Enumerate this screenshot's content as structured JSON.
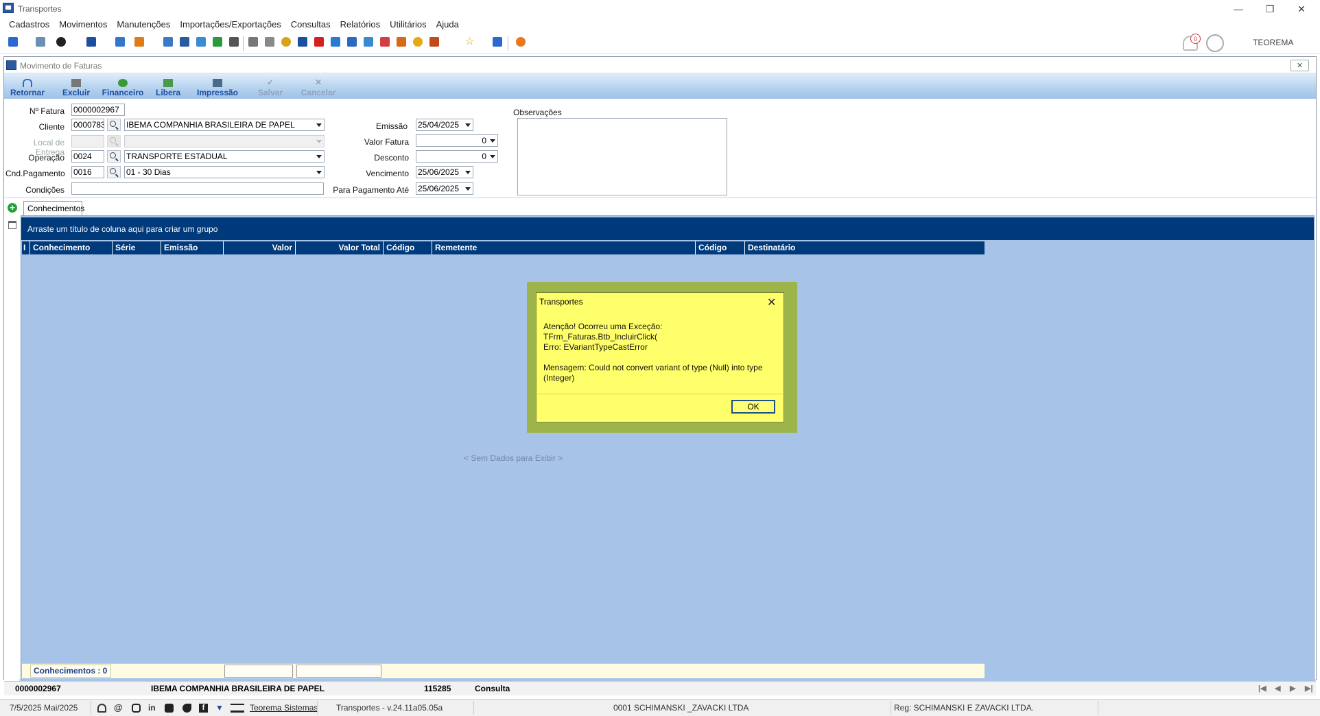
{
  "app": {
    "title": "Transportes",
    "user": "TEOREMA",
    "notifications": "0"
  },
  "menu": [
    "Cadastros",
    "Movimentos",
    "Manutenções",
    "Importações/Exportações",
    "Consultas",
    "Relatórios",
    "Utilitários",
    "Ajuda"
  ],
  "child_window": {
    "title": "Movimento de Faturas"
  },
  "ribbon": {
    "retornar": "Retornar",
    "excluir": "Excluir",
    "financeiro": "Financeiro",
    "libera": "Libera",
    "impressao": "Impressão",
    "salvar": "Salvar",
    "cancelar": "Cancelar"
  },
  "form": {
    "nfatura_label": "Nº Fatura",
    "nfatura": "0000002967",
    "cliente_label": "Cliente",
    "cliente_code": "0000783",
    "cliente_name": "IBEMA COMPANHIA BRASILEIRA DE PAPEL",
    "local_label": "Local de Entrega",
    "operacao_label": "Operação",
    "operacao_code": "0024",
    "operacao_name": "TRANSPORTE ESTADUAL",
    "cndpag_label": "Cnd.Pagamento",
    "cndpag_code": "0016",
    "cndpag_name": "01 - 30 Dias",
    "condicoes_label": "Condições",
    "condicoes": "",
    "emissao_label": "Emissão",
    "emissao": "25/04/2025",
    "valor_label": "Valor Fatura",
    "valor": "0",
    "desconto_label": "Desconto",
    "desconto": "0",
    "vencimento_label": "Vencimento",
    "vencimento": "25/06/2025",
    "pagamento_label": "Para Pagamento Até",
    "pagamento": "25/06/2025",
    "obs_label": "Observações"
  },
  "tabs": {
    "conhecimentos": "Conhecimentos"
  },
  "grid": {
    "group_hint": "Arraste um título de coluna aqui para criar um grupo",
    "indicator": "I",
    "columns": [
      "Conhecimento",
      "Série",
      "Emissão",
      "Valor",
      "Valor Total",
      "Código",
      "Remetente",
      "Código",
      "Destinatário"
    ],
    "no_data": "< Sem Dados para Exibir >",
    "footer_count": "Conhecimentos : 0"
  },
  "nav": {
    "fatura": "0000002967",
    "cliente": "IBEMA COMPANHIA BRASILEIRA DE PAPEL",
    "id": "115285",
    "mode": "Consulta"
  },
  "status": {
    "date": "7/5/2025 Mai/2025",
    "link": "Teorema Sistemas",
    "version": "Transportes - v.24.11a05.05a",
    "company": "0001 SCHIMANSKI _ZAVACKI LTDA",
    "reg": "Reg: SCHIMANSKI E ZAVACKI LTDA."
  },
  "dialog": {
    "title": "Transportes",
    "line1": "Atenção! Ocorreu uma Exceção: TFrm_Faturas.Btb_IncluirClick(",
    "line2": "Erro: EVariantTypeCastError",
    "line3": " Mensagem: Could not convert variant of type (Null) into type (Integer)",
    "ok": "OK"
  },
  "colors": {
    "grid_header": "#003a7a",
    "grid_bg": "#a7c3e8",
    "dialog_bg": "#ffff6b",
    "ribbon_text": "#1d4fa0"
  }
}
